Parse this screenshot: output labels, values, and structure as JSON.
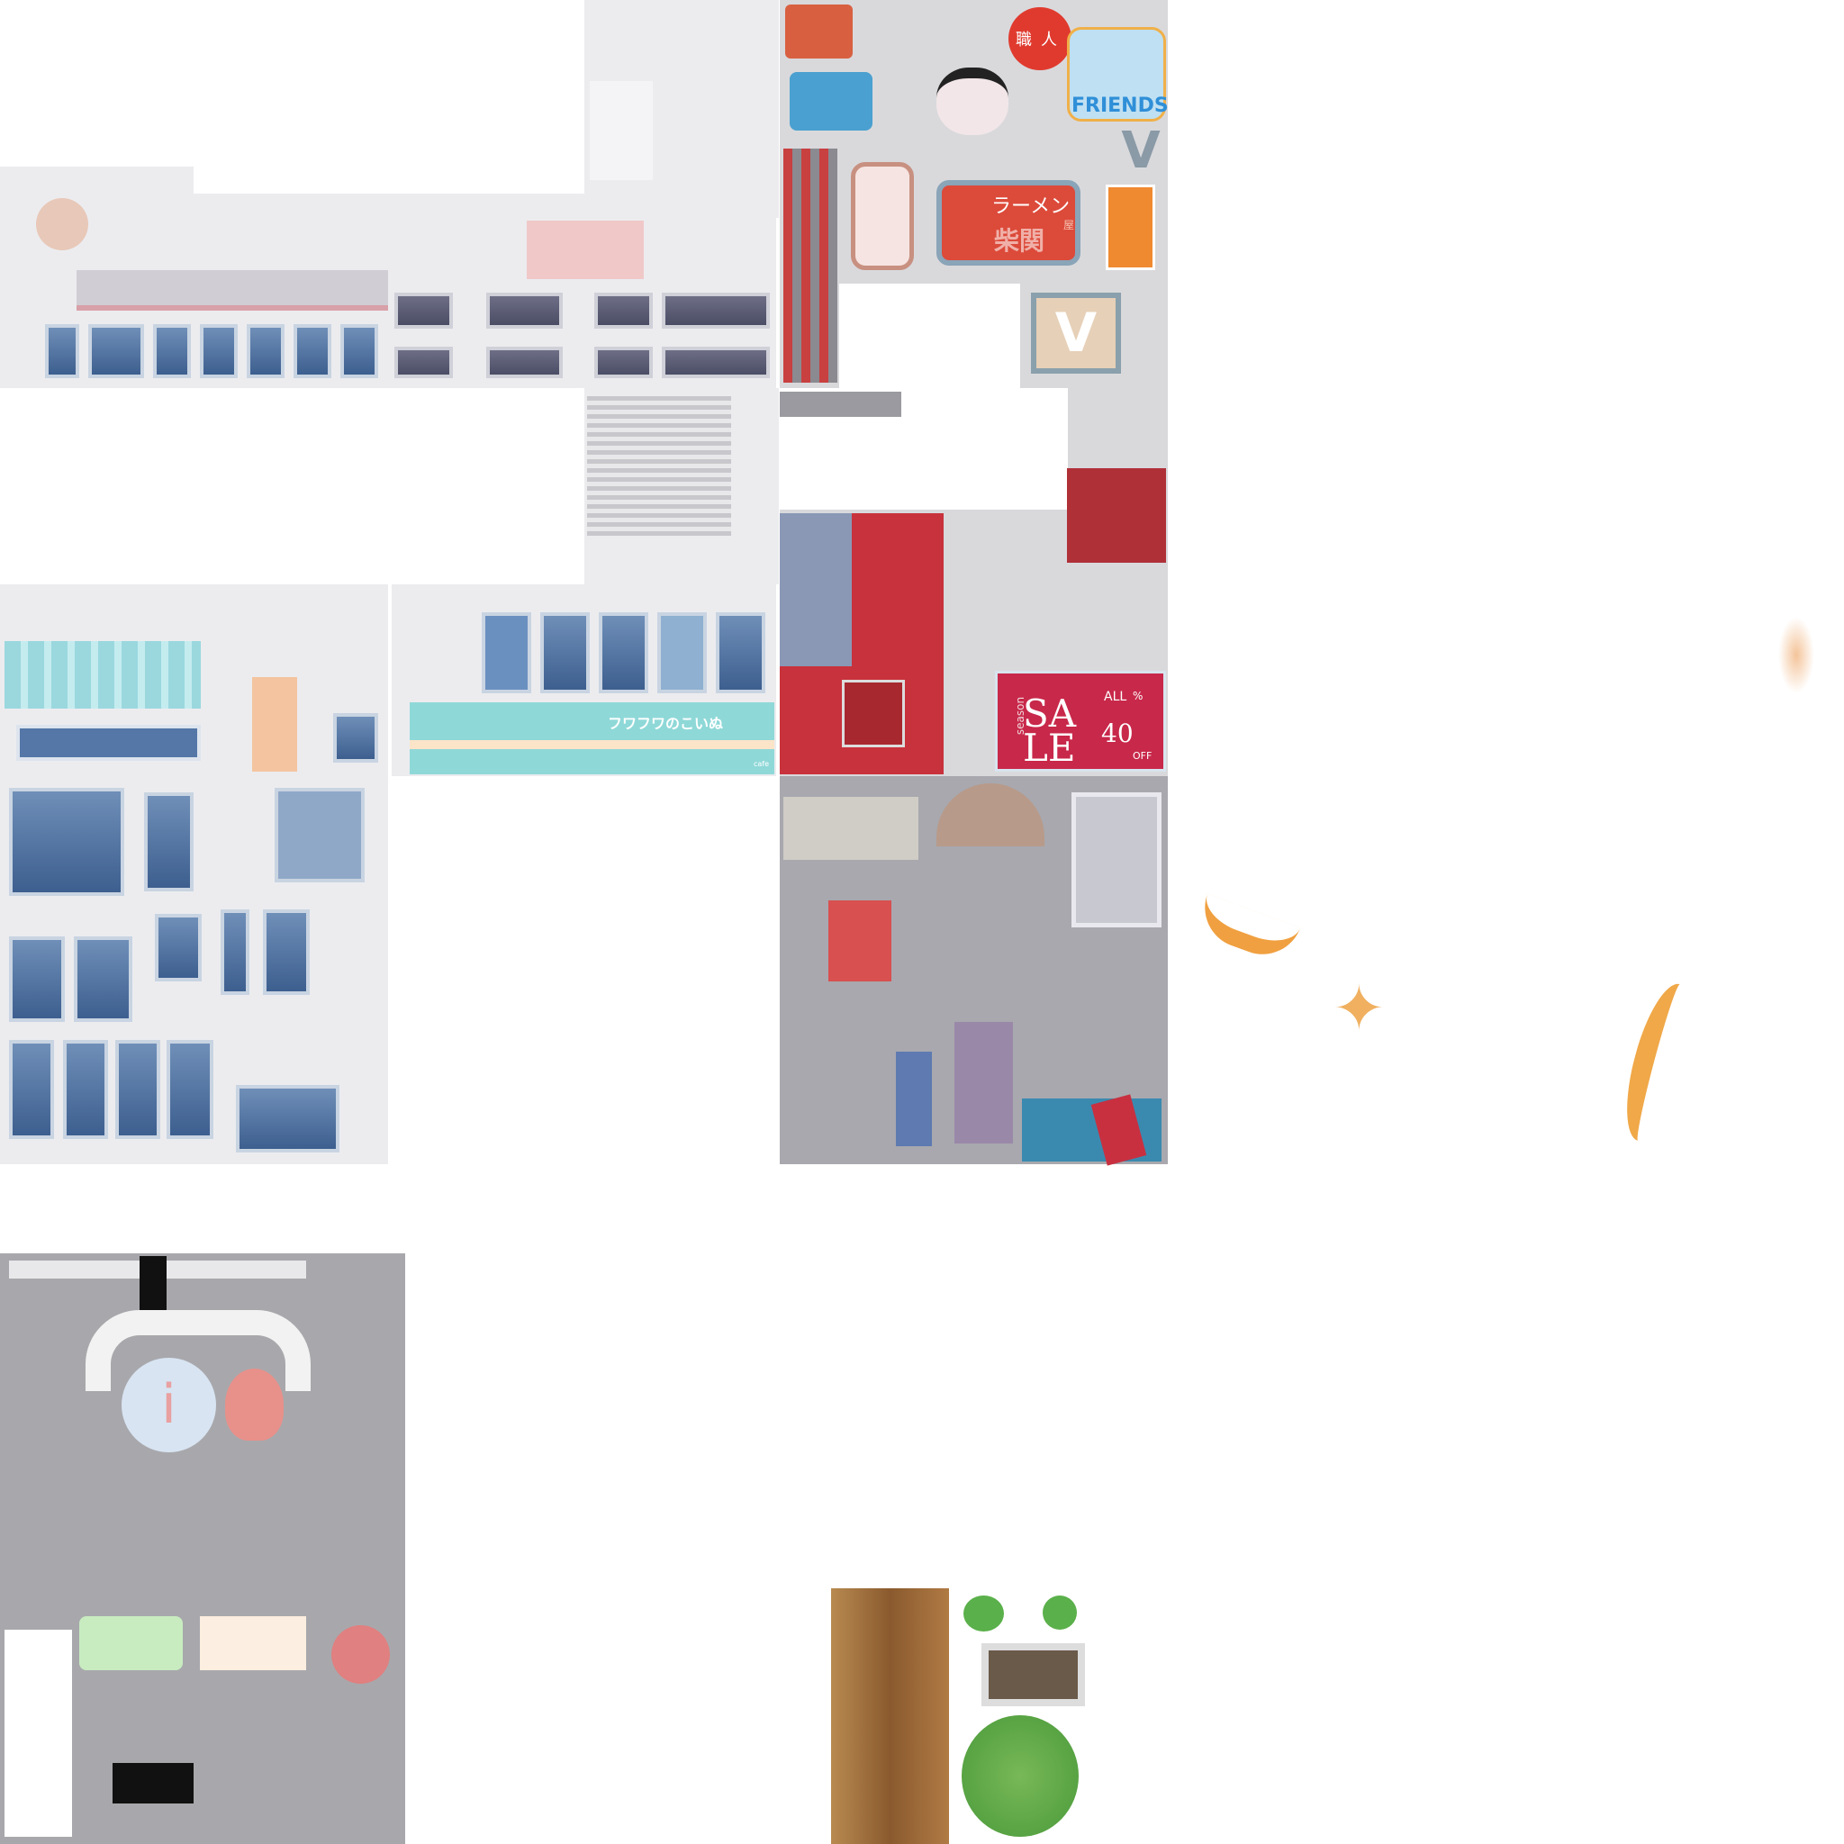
{
  "atlas": {
    "badge_shokunin": "職人",
    "friends_sticker": "FRIENDS",
    "ramen_sign": {
      "title": "ラーメン",
      "suffix": "屋",
      "name": "柴関"
    },
    "v_letter": "V",
    "sale_sign": {
      "season": "season",
      "sale_1": "SA",
      "sale_2": "LE",
      "all": "ALL",
      "percent": "%",
      "number": "40",
      "off": "OFF"
    },
    "cafe_sign": {
      "name": "フワフワのこいぬ",
      "tag": "cafe"
    },
    "info_sign": "i",
    "colors": {
      "red": "#c8323c",
      "cyan": "#8fd8d8",
      "orange": "#f0a040",
      "wood": "#9a6a3a",
      "window_blue": "#4a6d9c",
      "gray": "#c8c8cc"
    }
  }
}
